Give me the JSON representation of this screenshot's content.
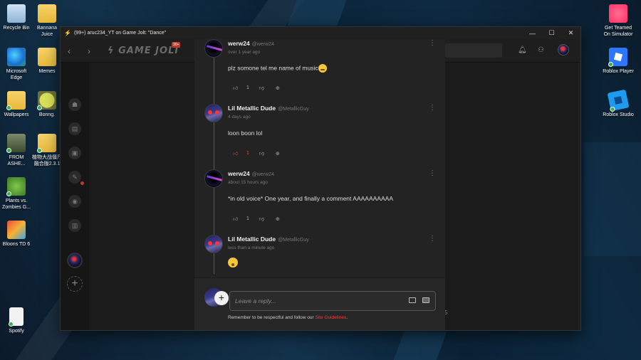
{
  "desktop": {
    "icons_left": [
      {
        "label": "Recycle Bin",
        "type": "bin"
      },
      {
        "label": "Bannana Juice",
        "type": "folder"
      },
      {
        "label": "Microsoft Edge",
        "type": "edge"
      },
      {
        "label": "Memes",
        "type": "folder"
      },
      {
        "label": "Wallpapers",
        "type": "folder"
      },
      {
        "label": "Bonng.",
        "type": "yellowdot"
      },
      {
        "label": "FROM ASHE...",
        "type": "game1"
      },
      {
        "label": "植物大战僵尸融合版2.3.1",
        "type": "folder"
      },
      {
        "label": "Plants vs. Zombies G...",
        "type": "pvz"
      },
      {
        "label": "Bloons TD 6",
        "type": "bloons"
      },
      {
        "label": "Spotify",
        "type": "file"
      }
    ],
    "icons_right": [
      {
        "label": "Get Teamed On Simulator",
        "type": "heart"
      },
      {
        "label": "Roblox Player",
        "type": "roblox"
      },
      {
        "label": "Roblox Studio",
        "type": "studio"
      }
    ]
  },
  "window": {
    "title": "(99+) aruc234_YT on Game Jolt: \"Dance\"",
    "controls": {
      "minimize": "—",
      "maximize": "☐",
      "close": "✕"
    }
  },
  "gamejolt": {
    "logo": "GAME JOLT",
    "logo_badge": "30+"
  },
  "comments": [
    {
      "author": "werw24",
      "handle": "@werw24",
      "time": "over 1 year ago",
      "body": "plz somone tel me name of music",
      "emoji": "😶",
      "likes": "1",
      "liked": false,
      "avatar": "dark"
    },
    {
      "author": "Lil Metallic Dude",
      "handle": "@MetallicGuy",
      "time": "4 days ago",
      "body": "loon boon lol",
      "emoji": "",
      "likes": "1",
      "liked": true,
      "avatar": "metal"
    },
    {
      "author": "werw24",
      "handle": "@werw24",
      "time": "about 15 hours ago",
      "body": "*in old voice* One year, and finally a comment AAAAAAAAAA",
      "emoji": "",
      "likes": "1",
      "liked": false,
      "avatar": "dark"
    },
    {
      "author": "Lil Metallic Dude",
      "handle": "@MetallicGuy",
      "time": "less than a minute ago",
      "body": "",
      "emoji": "😨",
      "likes": "",
      "liked": false,
      "avatar": "metal"
    }
  ],
  "reply": {
    "placeholder": "Leave a reply...",
    "guidelines_prefix": "Remember to be respectful and follow our ",
    "guidelines_link": "Site Guidelines",
    "guidelines_suffix": "."
  },
  "side_counter": "5",
  "colors": {
    "accent_red": "#ff3c3c",
    "modal_bg": "#232323",
    "window_bg": "#191919"
  }
}
